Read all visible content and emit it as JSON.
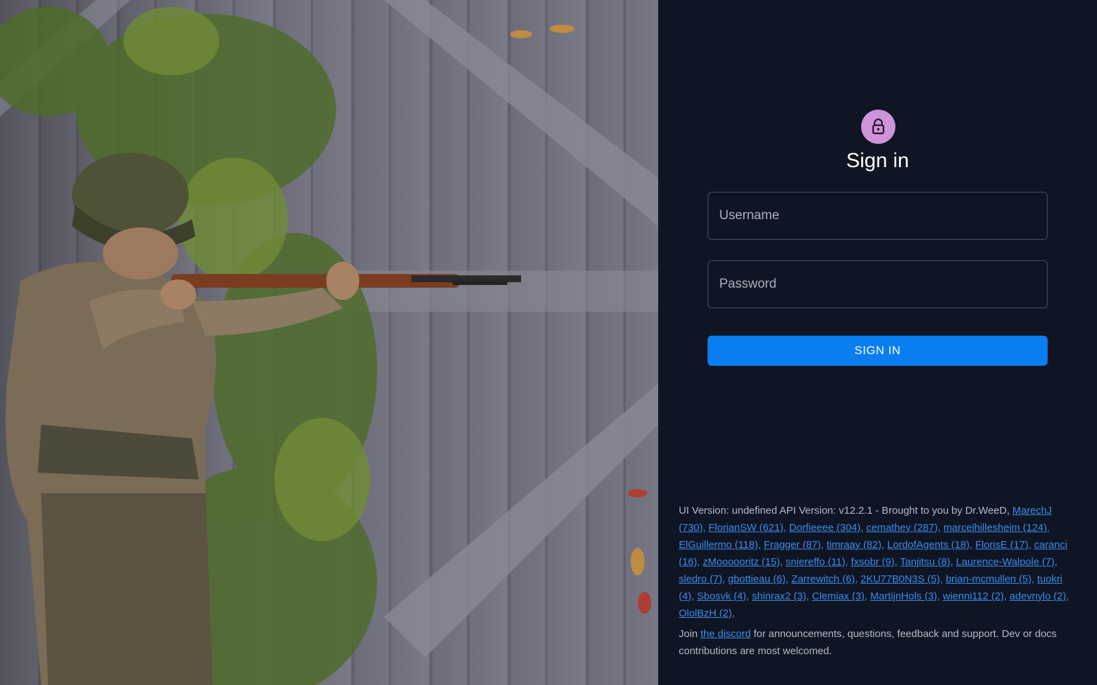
{
  "hero": {
    "image_description_icon": "soldier-with-rifle-illustration"
  },
  "login": {
    "lock_icon": "lock-icon",
    "title": "Sign in",
    "username_placeholder": "Username",
    "password_placeholder": "Password",
    "submit_label": "SIGN IN"
  },
  "footer": {
    "version_text": "UI Version: undefined API Version: v12.2.1 - Brought to you by Dr.WeeD, ",
    "contributors": [
      "MarechJ (730),",
      "FlorianSW (621),",
      "Dorfieeee (304),",
      "cemathey (287),",
      "marcelhillesheim (124),",
      "ElGuillermo (118),",
      "Fragger (87),",
      "timraay (82),",
      "LordofAgents (18),",
      "FlorisE (17),",
      "caranci (16),",
      "zMoooooritz (15),",
      "sniereffo (11),",
      "fxsobr (9),",
      "Tanjitsu (8),",
      "Laurence-Walpole (7),",
      "sledro (7),",
      "gbottieau (6),",
      "Zarrewitch (6),",
      "2KU77B0N3S (5),",
      "brian-mcmullen (5),",
      "tuokri (4),",
      "Sbosvk (4),",
      "shinrax2 (3),",
      "Clemiax (3),",
      "MartijnHols (3),",
      "wienni112 (2),",
      "adevnylo (2),",
      "OlolBzH (2),"
    ],
    "join_prefix": "Join ",
    "discord_link": "the discord",
    "join_suffix": " for announcements, questions, feedback and support. Dev or docs contributions are most welcomed."
  },
  "colors": {
    "background": "#0f1522",
    "accent": "#0a7ef0",
    "avatar": "#ce93d8",
    "link": "#3b8cf0"
  }
}
